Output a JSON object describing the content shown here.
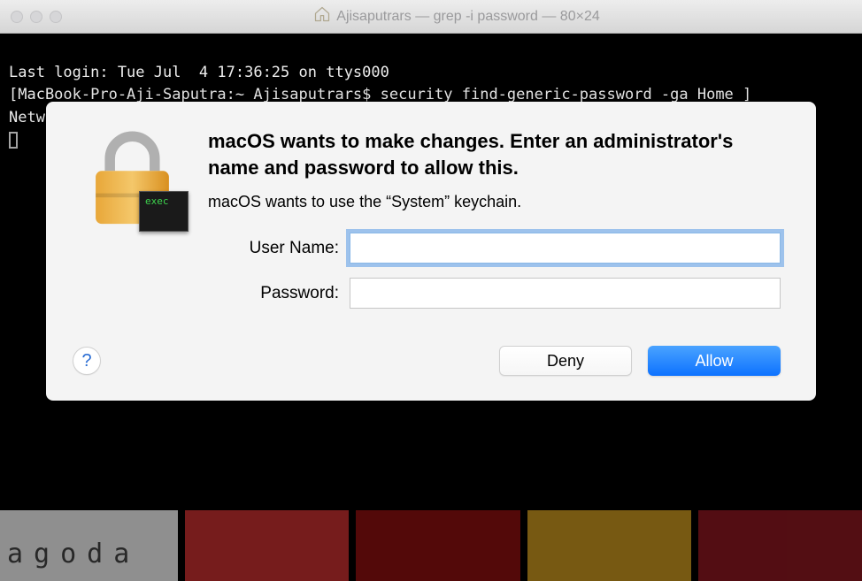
{
  "titlebar": {
    "title": "Ajisaputrars — grep -i password — 80×24"
  },
  "terminal": {
    "line1": "Last login: Tue Jul  4 17:36:25 on ttys000",
    "line2": "[MacBook-Pro-Aji-Saputra:~ Ajisaputrars$ security find-generic-password -ga Home_]",
    "line3": "Network | grep -i password"
  },
  "dialog": {
    "title": "macOS wants to make changes. Enter an administrator's name and password to allow this.",
    "subtitle": "macOS wants to use the “System” keychain.",
    "username_label": "User Name:",
    "username_value": "",
    "password_label": "Password:",
    "password_value": "",
    "deny_label": "Deny",
    "allow_label": "Allow",
    "exec_label": "exec",
    "help_label": "?"
  },
  "background": {
    "text": "agoda"
  }
}
